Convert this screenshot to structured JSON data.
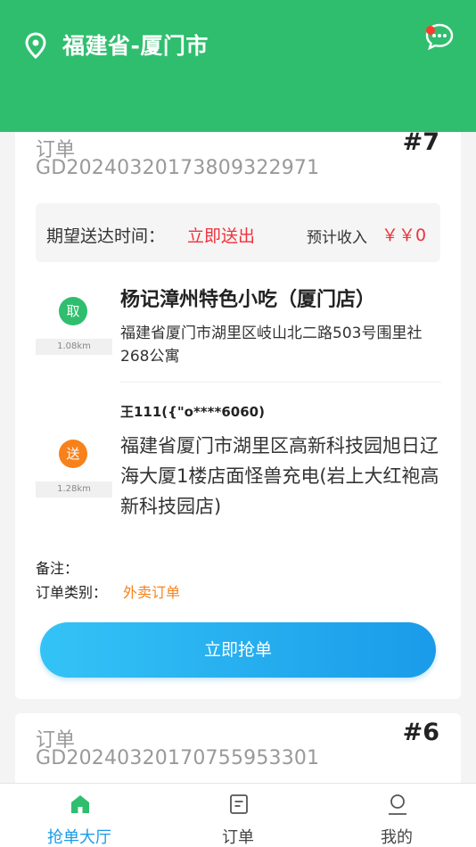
{
  "header": {
    "city": "福建省-厦门市",
    "location_icon": "location-pin-icon",
    "message_icon": "chat-bubble-icon",
    "accent": "#2fbe6e"
  },
  "orders": [
    {
      "label": "订单",
      "order_no": "GD2024032017380932​2971",
      "index": "#7",
      "expected_label": "期望送达时间：",
      "expected_value": "立即送出",
      "income_label": "预计收入",
      "income_value": "￥￥0",
      "pickup": {
        "badge": "取",
        "distance": "1.08km",
        "name": "杨记漳州特色小吃（厦门店）",
        "address": "福建省厦门市湖里区岐山北二路503号围里社268公寓"
      },
      "delivery": {
        "badge": "送",
        "distance": "1.28km",
        "name": "王111({\"o****6060)",
        "address": "福建省厦门市湖里区高新科技园旭日辽海大厦1楼店面怪兽充电(岩上大红袍高新科技园店)"
      },
      "remark_label": "备注：",
      "type_label": "订单类别：",
      "type_value": "外卖订单",
      "button_label": "立即抢单"
    },
    {
      "label": "订单",
      "order_no": "GD20240320170755953301",
      "index": "#6"
    }
  ],
  "tabbar": {
    "items": [
      {
        "label": "抢单大厅",
        "icon": "home-icon",
        "active": true
      },
      {
        "label": "订单",
        "icon": "order-list-icon",
        "active": false
      },
      {
        "label": "我的",
        "icon": "profile-icon",
        "active": false
      }
    ],
    "active_color": "#1a9be9"
  }
}
